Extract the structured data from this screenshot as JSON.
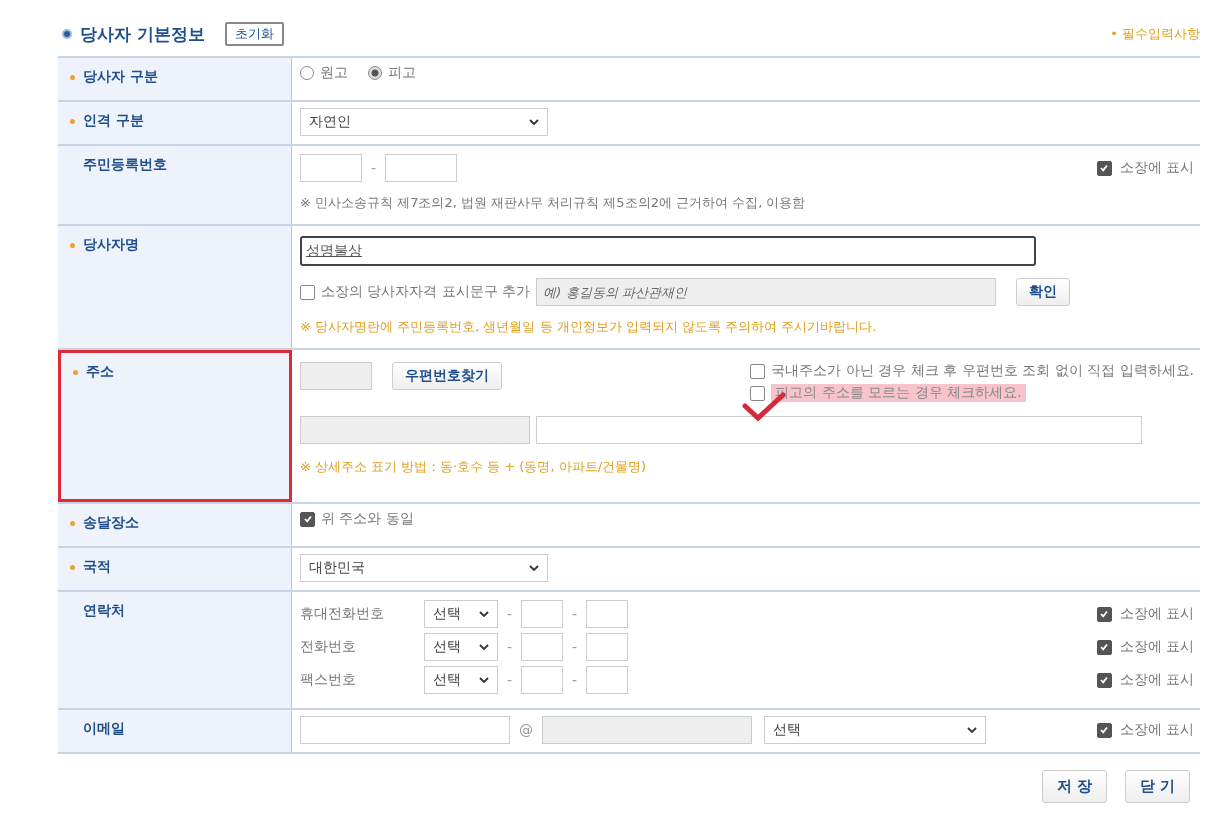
{
  "header": {
    "title": "당사자 기본정보",
    "reset_button": "초기화",
    "required_note": "• 필수입력사항"
  },
  "rows": [
    {
      "kind": "radio",
      "label": "당사자 구분",
      "required": true,
      "highlighted": false,
      "options": [
        {
          "label": "원고",
          "selected": false
        },
        {
          "label": "피고",
          "selected": true
        }
      ]
    },
    {
      "kind": "select",
      "label": "인격 구분",
      "required": true,
      "highlighted": false,
      "value": "자연인"
    },
    {
      "kind": "rrn",
      "label": "주민등록번호",
      "required": false,
      "highlighted": false,
      "separator": "-",
      "show_label": "소장에 표시",
      "show_checked": true,
      "note": "※ 민사소송규칙 제7조의2, 법원 재판사무 처리규칙 제5조의2에 근거하여 수집, 이용함"
    },
    {
      "kind": "name",
      "label": "당사자명",
      "required": true,
      "highlighted": false,
      "value": "성명불상",
      "qualifier_label": "소장의 당사자자격 표시문구 추가",
      "qualifier_checked": false,
      "qualifier_placeholder": "예) 홍길동의 파산관재인",
      "confirm_button": "확인",
      "note": "※ 당사자명란에 주민등록번호, 생년월일 등 개인정보가 입력되지 않도록 주의하여 주시기바랍니다."
    },
    {
      "kind": "address",
      "label": "주소",
      "required": true,
      "highlighted": true,
      "zip_button": "우편번호찾기",
      "options": [
        {
          "label": "국내주소가 아닌 경우 체크 후 우편번호 조회 없이 직접 입력하세요.",
          "checked": false,
          "highlighted": false,
          "marked": false
        },
        {
          "label": "피고의 주소를 모르는 경우 체크하세요.",
          "checked": false,
          "highlighted": true,
          "marked": true
        }
      ],
      "note": "※ 상세주소 표기 방법 : 동·호수 등 + (동명, 아파트/건물명)"
    },
    {
      "kind": "checkbox",
      "label": "송달장소",
      "required": true,
      "highlighted": false,
      "text": "위 주소와 동일",
      "checked": true
    },
    {
      "kind": "select",
      "label": "국적",
      "required": true,
      "highlighted": false,
      "value": "대한민국"
    },
    {
      "kind": "contacts",
      "label": "연락처",
      "required": false,
      "highlighted": false,
      "lines": [
        {
          "label": "휴대전화번호",
          "select": "선택",
          "separators": [
            "-",
            "-"
          ],
          "show_label": "소장에 표시",
          "show_checked": true
        },
        {
          "label": "전화번호",
          "select": "선택",
          "separators": [
            "-",
            "-"
          ],
          "show_label": "소장에 표시",
          "show_checked": true
        },
        {
          "label": "팩스번호",
          "select": "선택",
          "separators": [
            "-",
            "-"
          ],
          "show_label": "소장에 표시",
          "show_checked": true
        }
      ]
    },
    {
      "kind": "email",
      "label": "이메일",
      "required": false,
      "highlighted": false,
      "at": "@",
      "select": "선택",
      "show_label": "소장에 표시",
      "show_checked": true
    }
  ],
  "buttons": [
    "저 장",
    "닫 기"
  ]
}
